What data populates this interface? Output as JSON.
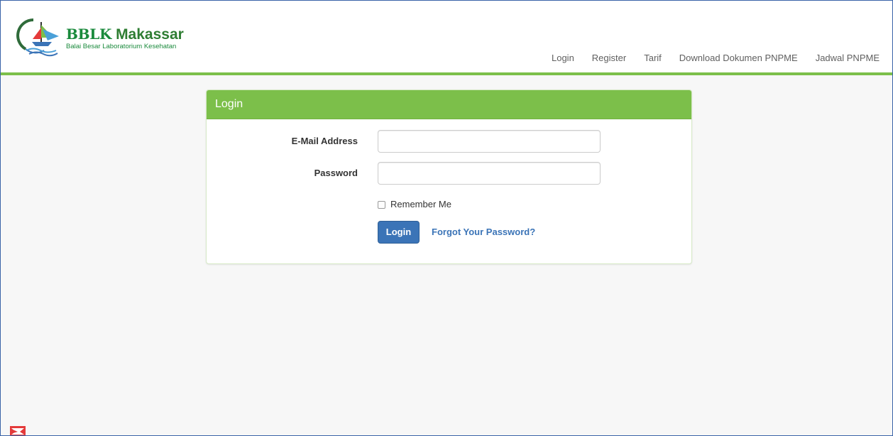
{
  "brand": {
    "logo_icon": "bblk-logo-icon",
    "title_bold": "BBLK",
    "title_rest": "Makassar",
    "subtitle": "Balai Besar Laboratorium Kesehatan"
  },
  "nav": {
    "items": [
      {
        "label": "Login"
      },
      {
        "label": "Register"
      },
      {
        "label": "Tarif"
      },
      {
        "label": "Download Dokumen PNPME"
      },
      {
        "label": "Jadwal PNPME"
      }
    ]
  },
  "login_panel": {
    "heading": "Login",
    "email_label": "E-Mail Address",
    "email_value": "",
    "password_label": "Password",
    "password_value": "",
    "remember_label": "Remember Me",
    "remember_checked": false,
    "submit_label": "Login",
    "forgot_label": "Forgot Your Password?"
  },
  "colors": {
    "accent_green": "#7cbf4a",
    "brand_green": "#1a8a3c",
    "primary_blue": "#3b74b7",
    "frame_border": "#3a63a8",
    "page_background": "#f7f7f7"
  },
  "taskbar": {
    "corner_icon": "app-corner-icon"
  }
}
